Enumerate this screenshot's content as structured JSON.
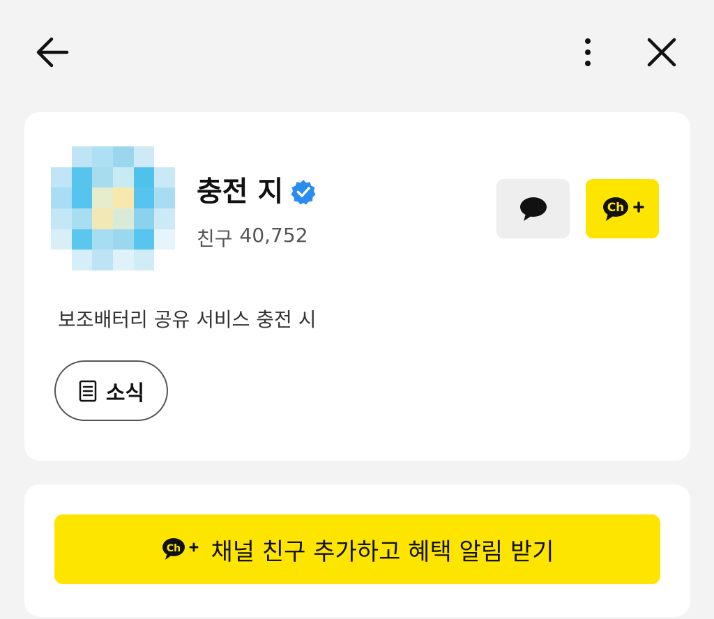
{
  "topbar": {
    "back_icon": "back-arrow-icon",
    "more_icon": "more-vertical-icon",
    "close_icon": "close-icon"
  },
  "profile": {
    "name": "충전   지",
    "verified_icon": "verified-badge-icon",
    "friends_label": "친구",
    "friends_count": "40,752",
    "description": "보조배터리 공유 서비스 충전   시",
    "chat_icon": "chat-bubble-icon",
    "add_channel_icon": "channel-add-icon",
    "news_label": "소식",
    "news_icon": "document-icon"
  },
  "cta": {
    "label": "채널 친구 추가하고 혜택 알림 받기",
    "icon": "channel-add-icon"
  },
  "colors": {
    "background": "#f3f3f3",
    "card": "#ffffff",
    "kakao_yellow": "#fee500",
    "verified_blue": "#2b8cf0",
    "text_primary": "#111111",
    "text_secondary": "#555555"
  },
  "avatar": {
    "description": "pixelated profile image"
  }
}
